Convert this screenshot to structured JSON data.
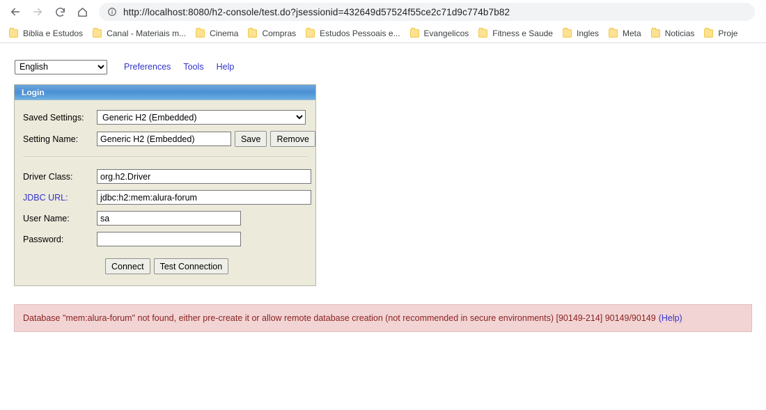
{
  "browser": {
    "nav": {
      "back_icon": "back-arrow-icon",
      "forward_icon": "forward-arrow-icon",
      "reload_icon": "reload-icon",
      "home_icon": "home-icon"
    },
    "omnibox": {
      "info_icon": "info-circle-icon",
      "url": "http://localhost:8080/h2-console/test.do?jsessionid=432649d57524f55ce2c71d9c774b7b82"
    },
    "bookmarks": [
      {
        "label": "Biblia e Estudos",
        "icon": "folder-icon"
      },
      {
        "label": "Canal - Materiais m...",
        "icon": "folder-icon"
      },
      {
        "label": "Cinema",
        "icon": "folder-icon"
      },
      {
        "label": "Compras",
        "icon": "folder-icon"
      },
      {
        "label": "Estudos Pessoais e...",
        "icon": "folder-icon"
      },
      {
        "label": "Evangelicos",
        "icon": "folder-icon"
      },
      {
        "label": "Fitness e Saude",
        "icon": "folder-icon"
      },
      {
        "label": "Ingles",
        "icon": "folder-icon"
      },
      {
        "label": "Meta",
        "icon": "folder-icon"
      },
      {
        "label": "Noticias",
        "icon": "folder-icon"
      },
      {
        "label": "Proje",
        "icon": "folder-icon"
      }
    ]
  },
  "toolbar": {
    "language_selected": "English",
    "language_options": [
      "English"
    ],
    "preferences_label": "Preferences",
    "tools_label": "Tools",
    "help_label": "Help"
  },
  "login": {
    "panel_title": "Login",
    "saved_settings_label": "Saved Settings:",
    "saved_settings_value": "Generic H2 (Embedded)",
    "saved_settings_options": [
      "Generic H2 (Embedded)"
    ],
    "setting_name_label": "Setting Name:",
    "setting_name_value": "Generic H2 (Embedded)",
    "save_label": "Save",
    "remove_label": "Remove",
    "driver_class_label": "Driver Class:",
    "driver_class_value": "org.h2.Driver",
    "jdbc_url_label": "JDBC URL:",
    "jdbc_url_value": "jdbc:h2:mem:alura-forum",
    "user_name_label": "User Name:",
    "user_name_value": "sa",
    "password_label": "Password:",
    "password_value": "",
    "connect_label": "Connect",
    "test_connection_label": "Test Connection"
  },
  "error": {
    "message": "Database \"mem:alura-forum\" not found, either pre-create it or allow remote database creation (not recommended in secure environments) [90149-214] 90149/90149",
    "help_label": "(Help)"
  },
  "colors": {
    "panel_background": "#eceadb",
    "panel_header_blue": "#4b90d4",
    "link_blue": "#3333cc",
    "error_background": "#f2d4d4",
    "error_text": "#8a1f1f",
    "bookmark_folder": "#fde293"
  }
}
